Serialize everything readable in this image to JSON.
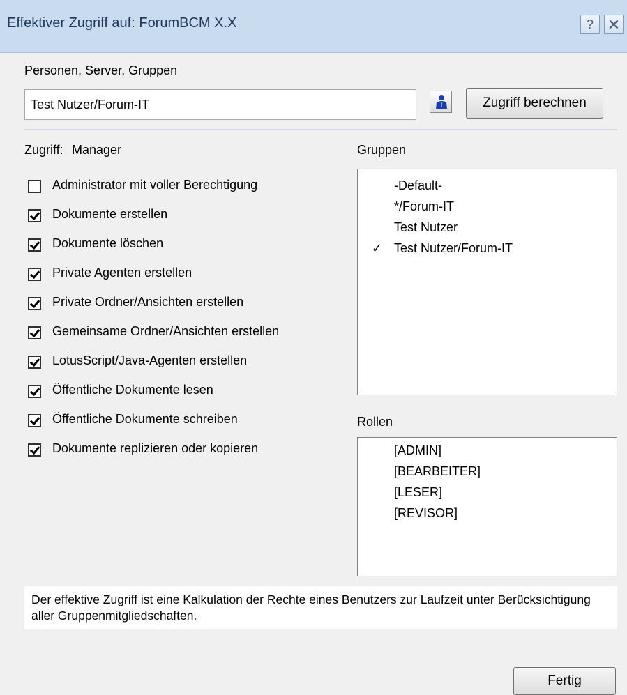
{
  "window": {
    "title": "Effektiver Zugriff auf: ForumBCM X.X",
    "help_label": "?",
    "close_label": "✕"
  },
  "search": {
    "label": "Personen, Server, Gruppen",
    "value": "Test Nutzer/Forum-IT",
    "calc_button": "Zugriff berechnen"
  },
  "access": {
    "label": "Zugriff:",
    "level": "Manager"
  },
  "permissions": [
    {
      "label": "Administrator mit voller Berechtigung",
      "checked": false
    },
    {
      "label": "Dokumente erstellen",
      "checked": true
    },
    {
      "label": "Dokumente löschen",
      "checked": true
    },
    {
      "label": "Private Agenten erstellen",
      "checked": true
    },
    {
      "label": "Private Ordner/Ansichten erstellen",
      "checked": true
    },
    {
      "label": "Gemeinsame Ordner/Ansichten erstellen",
      "checked": true
    },
    {
      "label": "LotusScript/Java-Agenten erstellen",
      "checked": true
    },
    {
      "label": "Öffentliche Dokumente lesen",
      "checked": true
    },
    {
      "label": "Öffentliche Dokumente schreiben",
      "checked": true
    },
    {
      "label": "Dokumente replizieren oder kopieren",
      "checked": true
    }
  ],
  "groups": {
    "label": "Gruppen",
    "items": [
      {
        "label": "-Default-",
        "selected": false
      },
      {
        "label": "*/Forum-IT",
        "selected": false
      },
      {
        "label": "Test Nutzer",
        "selected": false
      },
      {
        "label": "Test Nutzer/Forum-IT",
        "selected": true
      }
    ],
    "check_mark": "✓"
  },
  "roles": {
    "label": "Rollen",
    "items": [
      "[ADMIN]",
      "[BEARBEITER]",
      "[LESER]",
      "[REVISOR]"
    ]
  },
  "info_text": "Der effektive Zugriff ist eine Kalkulation der Rechte eines Benutzers zur Laufzeit unter Berücksichtigung aller Gruppenmitgliedschaften.",
  "done_button": "Fertig",
  "colors": {
    "titlebar": "#c9dbee",
    "title_text": "#1e395b",
    "person_icon": "#1a3fa8"
  }
}
